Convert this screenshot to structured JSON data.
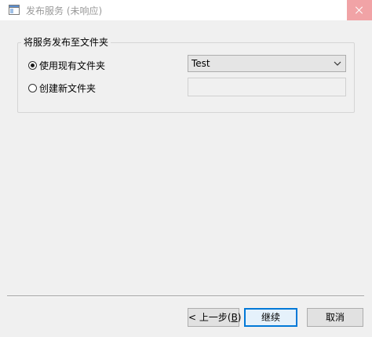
{
  "window": {
    "title": "发布服务 (未响应)"
  },
  "group": {
    "legend": "将服务发布至文件夹",
    "options": [
      {
        "label": "使用现有文件夹",
        "checked": true
      },
      {
        "label": "创建新文件夹",
        "checked": false
      }
    ],
    "existing_folder_value": "Test",
    "new_folder_value": ""
  },
  "buttons": {
    "back_prefix": "< 上一步(",
    "back_key": "B",
    "back_suffix": ")",
    "continue": "继续",
    "cancel": "取消"
  },
  "colors": {
    "close_button": "#f1a3a6",
    "primary_border": "#0078d7",
    "primary_bg": "#e5f1fb"
  }
}
